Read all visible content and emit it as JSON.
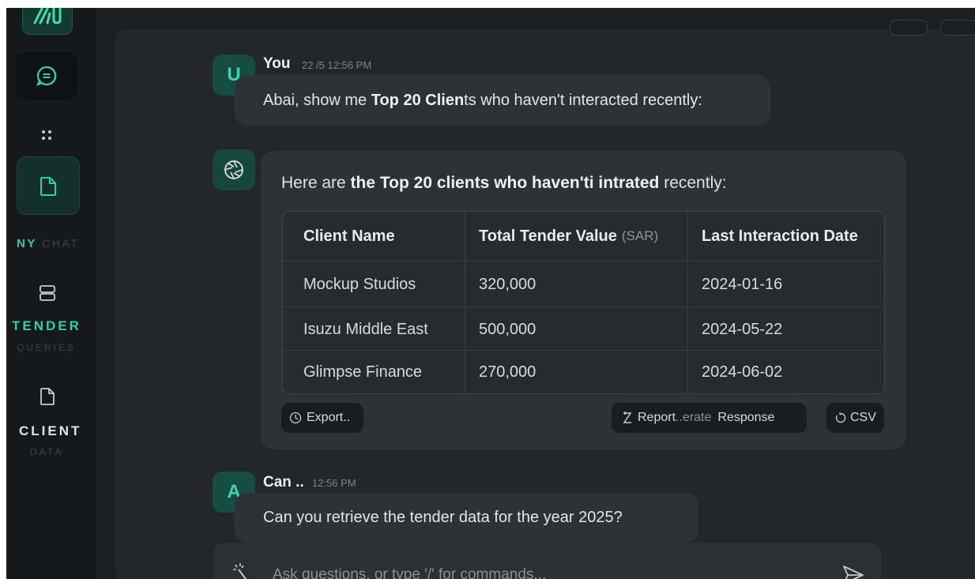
{
  "sidebar": {
    "nav_chat": {
      "strong": "NY",
      "light": "CHAT"
    },
    "nav_tender": {
      "title": "TENDER",
      "sub": "QUERIES"
    },
    "nav_client": {
      "title": "CLIENT",
      "sub": "DATA"
    },
    "accent": "#2fd0a3"
  },
  "messages": {
    "user1": {
      "avatar": "U",
      "name": "You",
      "time": "22 /5 12:56 PM",
      "text_pre": "Abai, show me ",
      "text_bold": "Top 20 Clien",
      "text_post": "ts who haven't interacted recently:"
    },
    "ai": {
      "intro_pre": "Here are ",
      "intro_bold": "the Top 20 clients who haven'ti intrated",
      "intro_post": " recently:",
      "table": {
        "headers": [
          "Client Name",
          "Total Tender Value",
          "Last Interaction Date"
        ],
        "unit": "(SAR)",
        "rows": [
          [
            "Mockup Studios",
            "320,000",
            "2024-01-16"
          ],
          [
            "Isuzu Middle East",
            "500,000",
            "2024-05-22"
          ],
          [
            "Glimpse Finance",
            "270,000",
            "2024-06-02"
          ]
        ]
      },
      "actions": {
        "export": "Export..",
        "report_a": "Report",
        "report_b": "..erate",
        "report_c": "Response",
        "csv": "CSV"
      }
    },
    "user2": {
      "avatar": "A",
      "name": "Can ..",
      "time": "12:56 PM",
      "text": "Can you retrieve the tender data for the year 2025?"
    }
  },
  "input": {
    "placeholder": "Ask questions, or type '/' for commands..."
  }
}
